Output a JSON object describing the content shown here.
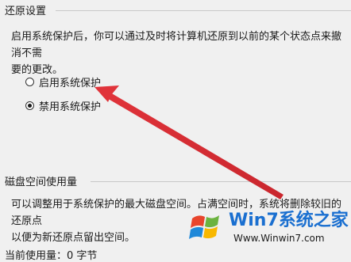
{
  "restore_settings": {
    "title": "还原设置",
    "description_line1": "启用系统保护后，你可以通过及时将计算机还原到以前的某个状态点来撤消不需",
    "description_line2": "要的更改。",
    "options": [
      {
        "label": "启用系统保护",
        "checked": false
      },
      {
        "label": "禁用系统保护",
        "checked": true
      }
    ]
  },
  "disk_usage": {
    "title": "磁盘空间使用量",
    "description_line1": "可以调整用于系统保护的最大磁盘空间。占满空间时，系统将删除较旧的还原点",
    "description_line2": "以便为新还原点留出空间。",
    "cutoff_label": "当前使用量：0 字节"
  },
  "watermark": {
    "brand": "Win7系统之家",
    "url": "Www.Winwin7.com"
  },
  "colors": {
    "arrow": "#e0333a",
    "brand": "#1a6fd0",
    "background": "#f0f0f0"
  }
}
